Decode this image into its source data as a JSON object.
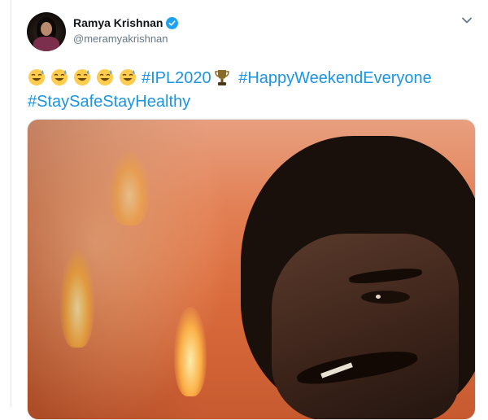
{
  "tweet": {
    "author_name": "Ramya Krishnan",
    "author_handle": "@meramyakrishnan",
    "verified": true,
    "text_emojis": [
      "sweat-smile",
      "sweat-smile",
      "sweat-smile",
      "sweat-smile",
      "sweat-smile"
    ],
    "hashtags": [
      "#IPL2020",
      "#HappyWeekendEveryone",
      "#StaySafeStayHealthy"
    ],
    "trophy_icon": "trophy-icon",
    "media_type": "video-gif"
  },
  "icons": {
    "verified": "verified-badge-icon",
    "menu": "chevron-down-icon"
  },
  "colors": {
    "link": "#1b95e0",
    "verified": "#1da1f2",
    "handle": "#657786",
    "border": "#e1e8ed"
  }
}
